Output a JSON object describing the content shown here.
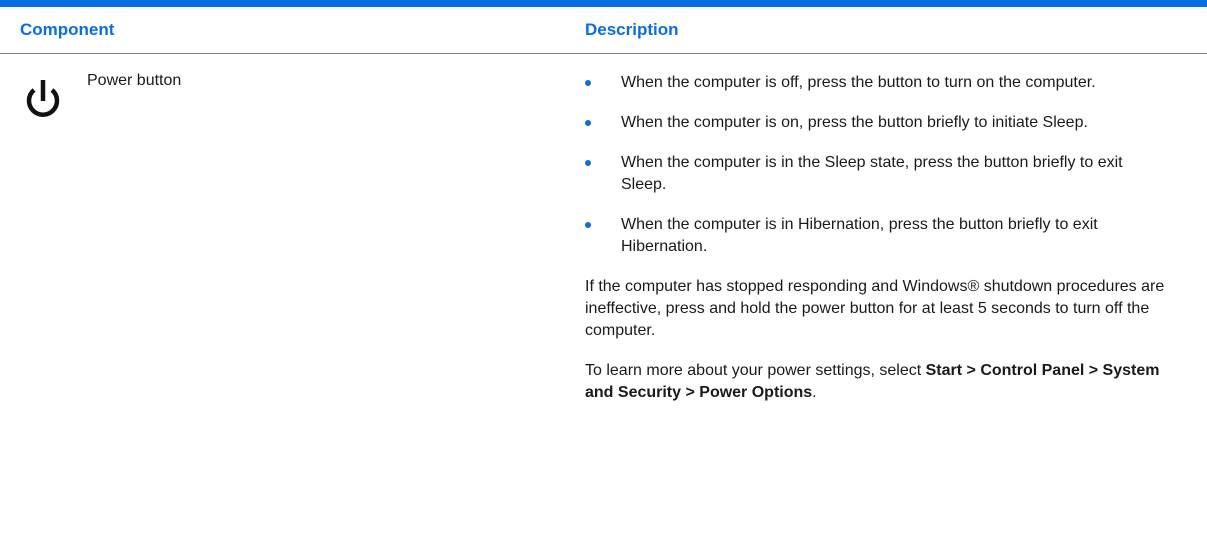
{
  "header": {
    "component": "Component",
    "description": "Description"
  },
  "colors": {
    "accent": "#0a6ee0",
    "text": "#1a1a1a"
  },
  "row": {
    "icon": "power-icon",
    "component": "Power button",
    "bullets": [
      "When the computer is off, press the button to turn on the computer.",
      "When the computer is on, press the button briefly to initiate Sleep.",
      "When the computer is in the Sleep state, press the button briefly to exit Sleep.",
      "When the computer is in Hibernation, press the button briefly to exit Hibernation."
    ],
    "note": "If the computer has stopped responding and Windows® shutdown procedures are ineffective, press and hold the power button for at least 5 seconds to turn off the computer.",
    "learn_more": {
      "prefix": "To learn more about your power settings, select ",
      "path": "Start > Control Panel > System and Security > Power Options",
      "suffix": "."
    }
  }
}
